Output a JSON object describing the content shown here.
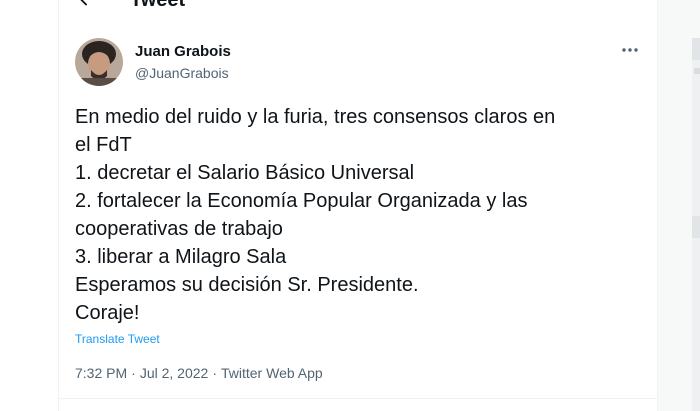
{
  "header": {
    "title": "Tweet"
  },
  "author": {
    "name": "Juan Grabois",
    "handle": "@JuanGrabois"
  },
  "tweet": {
    "lines": [
      "En medio del ruido y la furia, tres consensos claros en",
      "el FdT",
      "1. decretar el Salario Básico Universal",
      "2. fortalecer la Economía Popular Organizada y las",
      "cooperativas de trabajo",
      "3. liberar a Milagro Sala",
      "Esperamos su decisión Sr. Presidente.",
      "Coraje!"
    ],
    "translate_label": "Translate Tweet"
  },
  "meta": {
    "time": "7:32 PM",
    "date": "Jul 2, 2022",
    "source": "Twitter Web App",
    "separator": "·"
  },
  "colors": {
    "text": "#0f1419",
    "secondary": "#536471",
    "link": "#1d9bf0"
  },
  "icons": {
    "back": "arrow-left-icon",
    "more": "more-horizontal-icon"
  }
}
